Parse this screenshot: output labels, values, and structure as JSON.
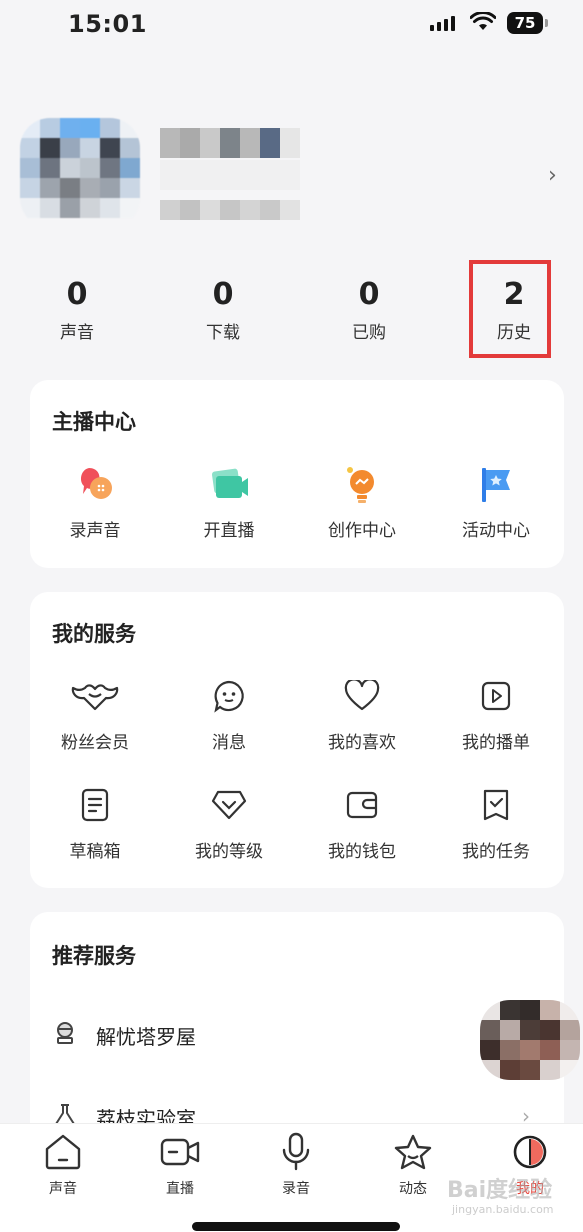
{
  "status": {
    "time": "15:01",
    "battery": "75"
  },
  "stats": [
    {
      "value": "0",
      "label": "声音"
    },
    {
      "value": "0",
      "label": "下载"
    },
    {
      "value": "0",
      "label": "已购"
    },
    {
      "value": "2",
      "label": "历史"
    }
  ],
  "anchor": {
    "title": "主播中心",
    "items": [
      {
        "label": "录声音",
        "icon": "record-voice-icon"
      },
      {
        "label": "开直播",
        "icon": "live-camera-icon"
      },
      {
        "label": "创作中心",
        "icon": "creation-bulb-icon"
      },
      {
        "label": "活动中心",
        "icon": "activity-flag-icon"
      }
    ]
  },
  "services": {
    "title": "我的服务",
    "items": [
      {
        "label": "粉丝会员",
        "icon": "fan-member-icon"
      },
      {
        "label": "消息",
        "icon": "message-icon"
      },
      {
        "label": "我的喜欢",
        "icon": "heart-icon"
      },
      {
        "label": "我的播单",
        "icon": "playlist-icon"
      },
      {
        "label": "草稿箱",
        "icon": "draft-icon"
      },
      {
        "label": "我的等级",
        "icon": "level-icon"
      },
      {
        "label": "我的钱包",
        "icon": "wallet-icon"
      },
      {
        "label": "我的任务",
        "icon": "task-icon"
      }
    ]
  },
  "recommend": {
    "title": "推荐服务",
    "items": [
      {
        "label": "解忧塔罗屋",
        "icon": "tarot-icon"
      },
      {
        "label": "荔枝实验室",
        "icon": "lab-flask-icon"
      }
    ]
  },
  "tabs": [
    {
      "label": "声音",
      "icon": "home-icon"
    },
    {
      "label": "直播",
      "icon": "video-icon"
    },
    {
      "label": "录音",
      "icon": "mic-icon"
    },
    {
      "label": "动态",
      "icon": "star-icon"
    },
    {
      "label": "我的",
      "icon": "profile-icon",
      "active": true
    }
  ],
  "colors": {
    "highlight": "#e33a3a",
    "active_tab": "#e8483f"
  },
  "watermark": {
    "main": "Bai度经验",
    "sub": "jingyan.baidu.com"
  }
}
